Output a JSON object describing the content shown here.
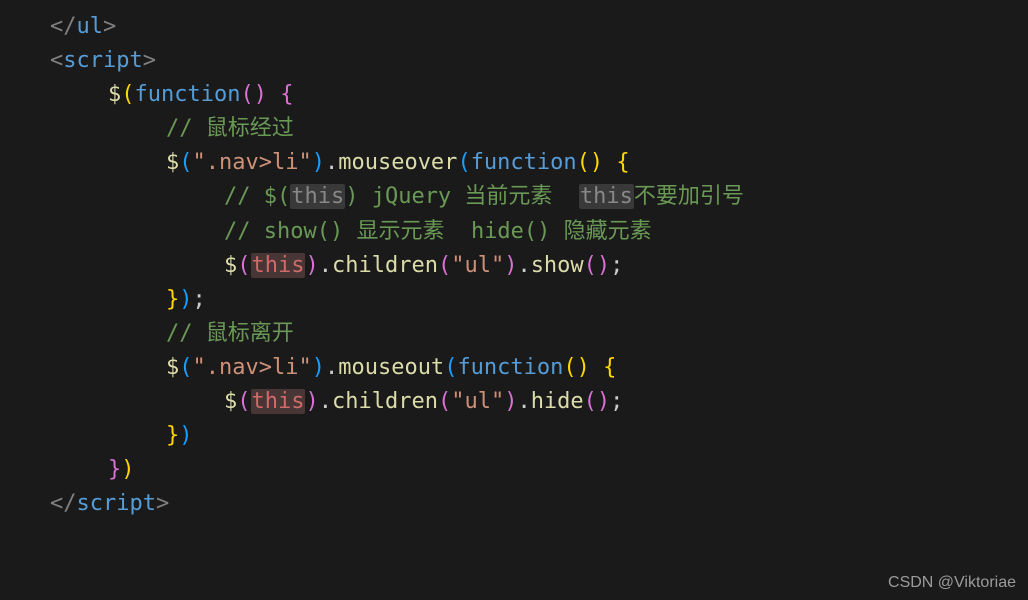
{
  "code": {
    "line1": {
      "close_ul_open": "</",
      "ul": "ul",
      "close": ">"
    },
    "line2": {
      "open": "<",
      "script": "script",
      "close": ">"
    },
    "line3": {
      "dollar": "$",
      "lp": "(",
      "func": "function",
      "lp2": "(",
      "rp2": ")",
      "sp": " ",
      "lb": "{"
    },
    "line4": {
      "cmt": "// 鼠标经过"
    },
    "line5": {
      "dollar": "$",
      "lp": "(",
      "str": "\".nav>li\"",
      "rp": ")",
      "dot": ".",
      "mouseover": "mouseover",
      "lp2": "(",
      "func": "function",
      "lp3": "(",
      "rp3": ")",
      "sp": " ",
      "lb": "{"
    },
    "line6": {
      "pre": "// $(",
      "this1": "this",
      "mid": ") jQuery 当前元素  ",
      "this2": "this",
      "post": "不要加引号"
    },
    "line7": {
      "cmt": "// show() 显示元素  hide() 隐藏元素"
    },
    "line8": {
      "dollar": "$",
      "lp": "(",
      "this": "this",
      "rp": ")",
      "dot1": ".",
      "children": "children",
      "lp2": "(",
      "str": "\"ul\"",
      "rp2": ")",
      "dot2": ".",
      "show": "show",
      "lp3": "(",
      "rp3": ")",
      "semi": ";"
    },
    "line9": {
      "rb": "}",
      "rp": ")",
      "semi": ";"
    },
    "line10": {
      "cmt": "// 鼠标离开"
    },
    "line11": {
      "dollar": "$",
      "lp": "(",
      "str": "\".nav>li\"",
      "rp": ")",
      "dot": ".",
      "mouseout": "mouseout",
      "lp2": "(",
      "func": "function",
      "lp3": "(",
      "rp3": ")",
      "sp": " ",
      "lb": "{"
    },
    "line12": {
      "dollar": "$",
      "lp": "(",
      "this": "this",
      "rp": ")",
      "dot1": ".",
      "children": "children",
      "lp2": "(",
      "str": "\"ul\"",
      "rp2": ")",
      "dot2": ".",
      "hide": "hide",
      "lp3": "(",
      "rp3": ")",
      "semi": ";"
    },
    "line13": {
      "rb": "}",
      "rp": ")"
    },
    "line14": {
      "rb": "}",
      "rp": ")"
    },
    "line15": {
      "open": "</",
      "script": "script",
      "close": ">"
    }
  },
  "watermark": "CSDN @Viktoriae"
}
